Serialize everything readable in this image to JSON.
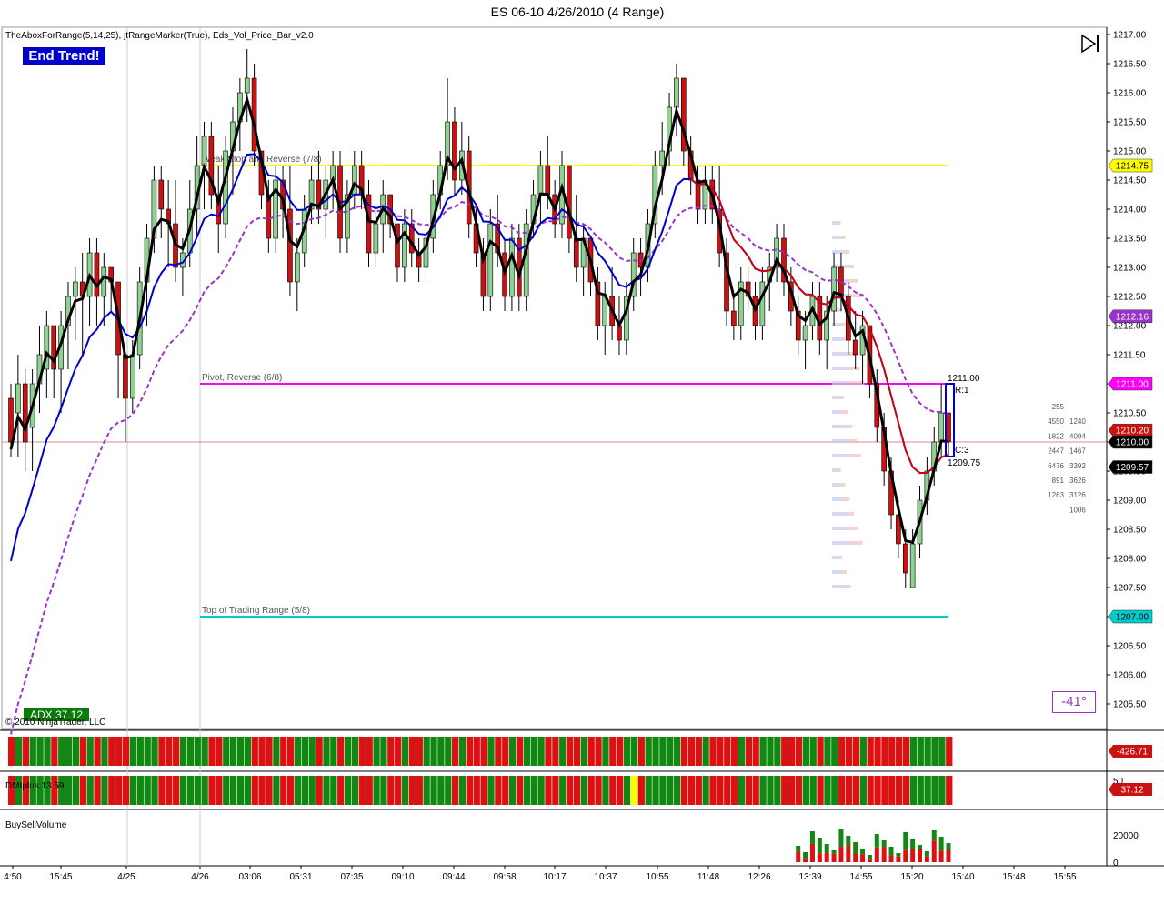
{
  "title": "ES 06-10  4/26/2010 (4 Range)",
  "indicators_label": "TheAboxForRange(5,14,25), jtRangeMarker(True), Eds_Vol_Price_Bar_v2.0",
  "end_trend_label": "End Trend!",
  "adx_label": "ADX 37.12",
  "angle_label": "-41°",
  "copyright": "© 2010 NinjaTrader, LLC",
  "dmi_label": "DMIplus 13.59",
  "bsv_label": "BuySellVolume",
  "icons": {
    "play_pause": "step-forward-icon"
  },
  "colors": {
    "up": "#8fd18f",
    "down": "#cc1111",
    "ema_fast": "#000000",
    "ema_mid": "#0000cc",
    "ema_slow": "#9933cc",
    "ema_red": "#dd0000",
    "yellow_line": "#ffff00",
    "magenta_line": "#ff00ff",
    "cyan_line": "#00cccc"
  },
  "chart_data": {
    "type": "candlestick",
    "price_axis": {
      "min": 1205.25,
      "max": 1217.0,
      "ticks": [
        "1217.00",
        "1216.50",
        "1216.00",
        "1215.50",
        "1215.00",
        "1214.50",
        "1214.00",
        "1213.50",
        "1213.00",
        "1212.50",
        "1212.00",
        "1211.50",
        "1211.00",
        "1210.50",
        "1210.00",
        "1209.50",
        "1209.00",
        "1208.50",
        "1208.00",
        "1207.50",
        "1207.00",
        "1206.50",
        "1206.00",
        "1205.50"
      ]
    },
    "x_ticks": [
      "4:50",
      "15:45",
      "4/25",
      "4/26",
      "03:06",
      "05:31",
      "07:35",
      "09:10",
      "09:44",
      "09:58",
      "10:17",
      "10:37",
      "10:55",
      "11:48",
      "12:26",
      "13:39",
      "14:55",
      "15:20",
      "15:40",
      "15:48",
      "15:55"
    ],
    "levels": [
      {
        "label": "Weak Stop and Reverse (7/8)",
        "value": 1214.75,
        "badge": "1214.75",
        "color": "#ffff00",
        "badge_text": "#000000"
      },
      {
        "label": "Pivot, Reverse (6/8)",
        "value": 1211.0,
        "badge": "1211.00",
        "color": "#ff00ff",
        "badge_text": "#ffffff"
      },
      {
        "label": "Top of Trading Range (5/8)",
        "value": 1207.0,
        "badge": "1207.00",
        "color": "#00cccc",
        "badge_text": "#000000"
      }
    ],
    "price_badges": [
      {
        "value": 1212.16,
        "label": "1212.16",
        "color": "#9933cc",
        "text": "#ffffff"
      },
      {
        "value": 1210.2,
        "label": "1210.20",
        "color": "#cc1111",
        "text": "#ffffff"
      },
      {
        "value": 1210.0,
        "label": "1210.00",
        "color": "#000000",
        "text": "#ffffff"
      },
      {
        "value": 1209.57,
        "label": "1209.57",
        "color": "#000000",
        "text": "#ffffff"
      }
    ],
    "current_price_line": 1210.0,
    "range_box": {
      "high_label": "1211.00",
      "r_label": "R:1",
      "c_label": "C:3",
      "low_label": "1209.75"
    },
    "volume_profile": {
      "left": [
        "255",
        "4550",
        "1822",
        "2447",
        "6476",
        "891",
        "1263",
        ""
      ],
      "right": [
        "",
        "1240",
        "4094",
        "1467",
        "3392",
        "3626",
        "3126",
        "1006"
      ]
    },
    "panes": {
      "osc1": {
        "badge": "-426.71"
      },
      "dmi": {
        "badge": "37.12",
        "tick": "50"
      },
      "bsv": {
        "ticks": [
          "20000",
          "0"
        ]
      }
    },
    "candles": [
      [
        1210.75,
        1211.0,
        1209.75,
        1210.0
      ],
      [
        1210.5,
        1211.5,
        1209.75,
        1211.0
      ],
      [
        1211.0,
        1211.25,
        1209.5,
        1210.0
      ],
      [
        1210.25,
        1211.25,
        1209.5,
        1211.0
      ],
      [
        1211.0,
        1212.0,
        1210.5,
        1211.5
      ],
      [
        1211.25,
        1212.25,
        1210.75,
        1212.0
      ],
      [
        1212.0,
        1212.0,
        1210.75,
        1211.25
      ],
      [
        1211.25,
        1212.25,
        1210.5,
        1212.0
      ],
      [
        1212.0,
        1212.75,
        1211.25,
        1212.5
      ],
      [
        1212.5,
        1213.0,
        1211.75,
        1212.75
      ],
      [
        1212.75,
        1213.25,
        1211.5,
        1212.5
      ],
      [
        1212.5,
        1213.5,
        1212.0,
        1213.25
      ],
      [
        1213.25,
        1213.5,
        1212.0,
        1212.5
      ],
      [
        1212.5,
        1213.25,
        1212.0,
        1213.0
      ],
      [
        1213.0,
        1213.0,
        1212.25,
        1212.75
      ],
      [
        1212.75,
        1212.75,
        1210.75,
        1211.5
      ],
      [
        1211.5,
        1211.5,
        1210.0,
        1210.75
      ],
      [
        1210.75,
        1211.75,
        1210.5,
        1211.5
      ],
      [
        1211.5,
        1213.0,
        1211.25,
        1212.75
      ],
      [
        1212.75,
        1213.75,
        1212.0,
        1213.5
      ],
      [
        1213.5,
        1214.75,
        1213.25,
        1214.5
      ],
      [
        1214.5,
        1214.75,
        1213.5,
        1214.0
      ],
      [
        1214.0,
        1214.5,
        1213.0,
        1213.75
      ],
      [
        1213.75,
        1214.5,
        1212.75,
        1213.0
      ],
      [
        1213.0,
        1213.5,
        1212.5,
        1213.25
      ],
      [
        1213.25,
        1214.5,
        1213.0,
        1214.0
      ],
      [
        1214.0,
        1215.25,
        1213.5,
        1214.75
      ],
      [
        1214.75,
        1215.5,
        1214.0,
        1215.25
      ],
      [
        1215.25,
        1215.5,
        1214.0,
        1214.25
      ],
      [
        1214.25,
        1214.75,
        1213.25,
        1213.75
      ],
      [
        1213.75,
        1215.25,
        1213.5,
        1215.0
      ],
      [
        1215.0,
        1215.75,
        1214.25,
        1215.5
      ],
      [
        1215.5,
        1216.25,
        1215.0,
        1216.0
      ],
      [
        1216.0,
        1216.75,
        1215.5,
        1216.25
      ],
      [
        1216.25,
        1216.5,
        1214.75,
        1215.0
      ],
      [
        1215.0,
        1215.0,
        1214.0,
        1214.25
      ],
      [
        1214.25,
        1214.5,
        1213.25,
        1213.5
      ],
      [
        1213.5,
        1214.75,
        1213.25,
        1214.5
      ],
      [
        1214.5,
        1214.75,
        1213.5,
        1214.0
      ],
      [
        1214.0,
        1214.75,
        1212.5,
        1212.75
      ],
      [
        1212.75,
        1213.5,
        1212.25,
        1213.25
      ],
      [
        1213.25,
        1214.25,
        1213.0,
        1214.0
      ],
      [
        1214.0,
        1214.75,
        1213.75,
        1214.5
      ],
      [
        1214.5,
        1215.0,
        1213.75,
        1214.0
      ],
      [
        1214.0,
        1214.75,
        1213.5,
        1214.5
      ],
      [
        1214.5,
        1215.0,
        1214.0,
        1214.75
      ],
      [
        1214.75,
        1215.0,
        1213.25,
        1213.5
      ],
      [
        1213.5,
        1214.5,
        1213.25,
        1214.25
      ],
      [
        1214.25,
        1215.0,
        1214.0,
        1214.75
      ],
      [
        1214.75,
        1215.0,
        1214.0,
        1214.25
      ],
      [
        1214.25,
        1214.5,
        1213.0,
        1213.25
      ],
      [
        1213.25,
        1214.0,
        1213.0,
        1213.75
      ],
      [
        1213.75,
        1214.5,
        1213.25,
        1214.25
      ],
      [
        1214.25,
        1214.25,
        1213.5,
        1213.75
      ],
      [
        1213.75,
        1213.75,
        1212.75,
        1213.0
      ],
      [
        1213.0,
        1214.0,
        1212.75,
        1213.75
      ],
      [
        1213.75,
        1214.0,
        1213.0,
        1213.25
      ],
      [
        1213.25,
        1213.5,
        1212.75,
        1213.0
      ],
      [
        1213.0,
        1213.75,
        1212.75,
        1213.5
      ],
      [
        1213.5,
        1214.5,
        1213.25,
        1214.25
      ],
      [
        1214.25,
        1215.0,
        1214.0,
        1214.75
      ],
      [
        1214.75,
        1216.25,
        1214.5,
        1215.5
      ],
      [
        1215.5,
        1215.75,
        1214.25,
        1214.5
      ],
      [
        1214.5,
        1215.5,
        1214.25,
        1215.0
      ],
      [
        1215.0,
        1215.25,
        1213.5,
        1213.75
      ],
      [
        1213.75,
        1214.0,
        1213.0,
        1213.25
      ],
      [
        1213.25,
        1213.5,
        1212.25,
        1212.5
      ],
      [
        1212.5,
        1214.0,
        1212.25,
        1213.75
      ],
      [
        1213.75,
        1214.25,
        1213.0,
        1213.25
      ],
      [
        1213.25,
        1213.5,
        1212.25,
        1212.5
      ],
      [
        1212.5,
        1213.75,
        1212.25,
        1213.5
      ],
      [
        1213.5,
        1213.75,
        1212.25,
        1212.5
      ],
      [
        1212.5,
        1214.0,
        1212.25,
        1213.75
      ],
      [
        1213.75,
        1214.5,
        1213.5,
        1214.25
      ],
      [
        1214.25,
        1215.0,
        1213.75,
        1214.75
      ],
      [
        1214.75,
        1215.25,
        1214.0,
        1214.25
      ],
      [
        1214.25,
        1214.5,
        1213.5,
        1213.75
      ],
      [
        1213.75,
        1215.0,
        1213.5,
        1214.75
      ],
      [
        1214.75,
        1214.75,
        1213.25,
        1213.5
      ],
      [
        1213.5,
        1214.25,
        1212.75,
        1213.0
      ],
      [
        1213.0,
        1213.75,
        1212.5,
        1213.5
      ],
      [
        1213.5,
        1213.5,
        1212.5,
        1212.75
      ],
      [
        1212.75,
        1213.0,
        1211.75,
        1212.0
      ],
      [
        1212.0,
        1212.75,
        1211.5,
        1212.5
      ],
      [
        1212.5,
        1213.0,
        1211.75,
        1212.0
      ],
      [
        1212.0,
        1212.5,
        1211.5,
        1211.75
      ],
      [
        1211.75,
        1212.75,
        1211.5,
        1212.5
      ],
      [
        1212.5,
        1213.5,
        1212.25,
        1213.25
      ],
      [
        1213.25,
        1213.5,
        1212.5,
        1213.0
      ],
      [
        1213.0,
        1214.0,
        1212.75,
        1213.75
      ],
      [
        1213.75,
        1215.0,
        1213.5,
        1214.75
      ],
      [
        1214.75,
        1215.5,
        1214.25,
        1215.0
      ],
      [
        1215.0,
        1216.0,
        1214.75,
        1215.75
      ],
      [
        1215.75,
        1216.5,
        1215.25,
        1216.25
      ],
      [
        1216.25,
        1216.25,
        1214.75,
        1215.0
      ],
      [
        1215.0,
        1215.25,
        1214.25,
        1214.5
      ],
      [
        1214.5,
        1214.75,
        1213.75,
        1214.0
      ],
      [
        1214.0,
        1214.75,
        1213.75,
        1214.5
      ],
      [
        1214.5,
        1214.75,
        1213.75,
        1214.0
      ],
      [
        1214.0,
        1214.75,
        1213.0,
        1213.25
      ],
      [
        1213.25,
        1213.5,
        1212.0,
        1212.25
      ],
      [
        1212.25,
        1212.5,
        1211.75,
        1212.0
      ],
      [
        1212.0,
        1213.0,
        1211.75,
        1212.75
      ],
      [
        1212.75,
        1213.0,
        1212.25,
        1212.5
      ],
      [
        1212.5,
        1212.75,
        1211.75,
        1212.0
      ],
      [
        1212.0,
        1213.0,
        1211.75,
        1212.75
      ],
      [
        1212.75,
        1213.25,
        1212.25,
        1213.0
      ],
      [
        1213.0,
        1213.75,
        1212.75,
        1213.5
      ],
      [
        1213.5,
        1213.75,
        1212.5,
        1212.75
      ],
      [
        1212.75,
        1213.0,
        1212.0,
        1212.25
      ],
      [
        1212.25,
        1212.5,
        1211.5,
        1211.75
      ],
      [
        1211.75,
        1212.25,
        1211.25,
        1212.0
      ],
      [
        1212.0,
        1212.75,
        1211.75,
        1212.5
      ],
      [
        1212.5,
        1212.75,
        1211.5,
        1211.75
      ],
      [
        1211.75,
        1212.5,
        1211.25,
        1212.25
      ],
      [
        1212.25,
        1213.25,
        1212.0,
        1213.0
      ],
      [
        1213.0,
        1213.25,
        1212.25,
        1212.5
      ],
      [
        1212.5,
        1212.75,
        1211.5,
        1211.75
      ],
      [
        1211.75,
        1212.25,
        1211.25,
        1211.5
      ],
      [
        1211.5,
        1212.25,
        1211.0,
        1212.0
      ],
      [
        1212.0,
        1212.0,
        1210.75,
        1211.0
      ],
      [
        1211.0,
        1211.25,
        1210.0,
        1210.25
      ],
      [
        1210.25,
        1210.5,
        1209.25,
        1209.5
      ],
      [
        1209.5,
        1209.75,
        1208.5,
        1208.75
      ],
      [
        1208.75,
        1209.0,
        1208.0,
        1208.25
      ],
      [
        1208.25,
        1208.5,
        1207.5,
        1207.75
      ],
      [
        1207.5,
        1208.5,
        1207.5,
        1208.25
      ],
      [
        1208.25,
        1209.25,
        1208.0,
        1209.0
      ],
      [
        1209.0,
        1209.75,
        1208.75,
        1209.5
      ],
      [
        1209.5,
        1210.25,
        1209.25,
        1210.0
      ],
      [
        1210.0,
        1211.0,
        1209.75,
        1210.5
      ],
      [
        1210.5,
        1210.5,
        1209.75,
        1210.0
      ]
    ]
  }
}
